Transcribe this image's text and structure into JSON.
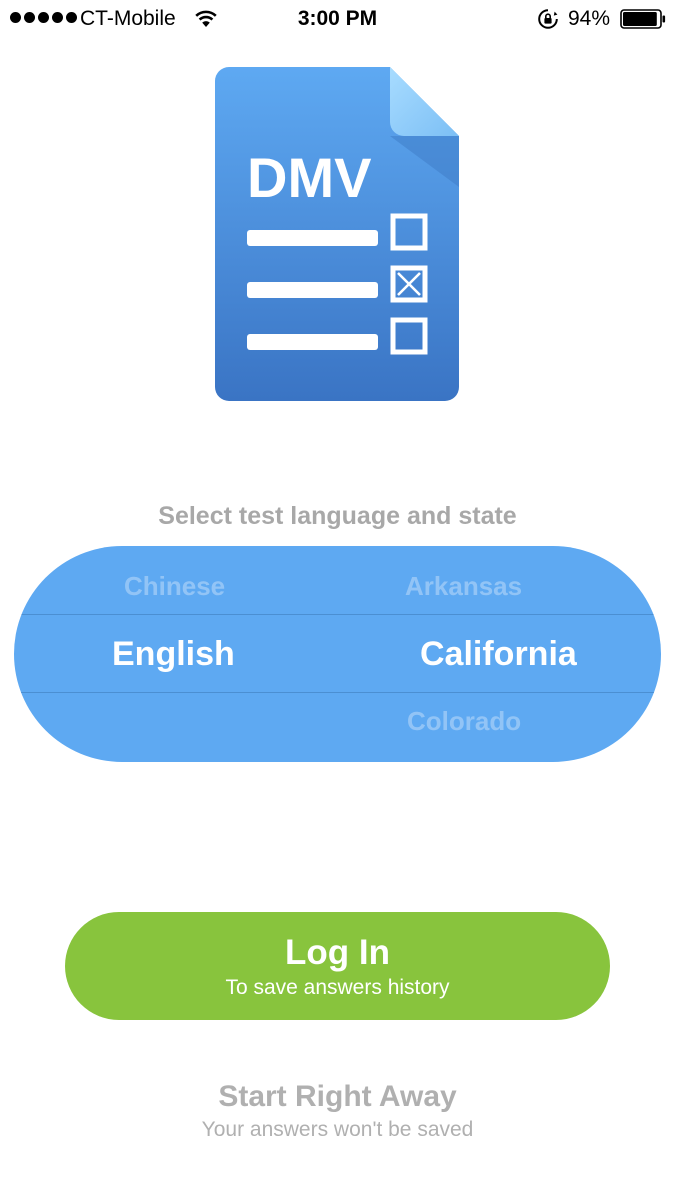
{
  "status_bar": {
    "carrier": "CT-Mobile",
    "time": "3:00 PM",
    "battery_percent": "94%",
    "battery_level": 0.94,
    "signal_bars": 5,
    "icons": [
      "signal-dots",
      "wifi-icon",
      "orientation-lock-icon",
      "battery-icon"
    ]
  },
  "logo": {
    "text": "DMV",
    "checkboxes": [
      false,
      true,
      false
    ],
    "colors": {
      "top": "#5ea9f2",
      "bottom": "#3a74c4",
      "fold": "#9bd1fb"
    }
  },
  "prompt": "Select test language and state",
  "picker": {
    "language": {
      "previous": "Chinese",
      "selected": "English",
      "next": ""
    },
    "state": {
      "previous": "Arkansas",
      "selected": "California",
      "next": "Colorado"
    },
    "background": "#5ea9f2"
  },
  "login": {
    "title": "Log In",
    "subtitle": "To save answers history",
    "color": "#88c43d"
  },
  "start": {
    "title": "Start Right Away",
    "subtitle": "Your answers won't be saved"
  }
}
